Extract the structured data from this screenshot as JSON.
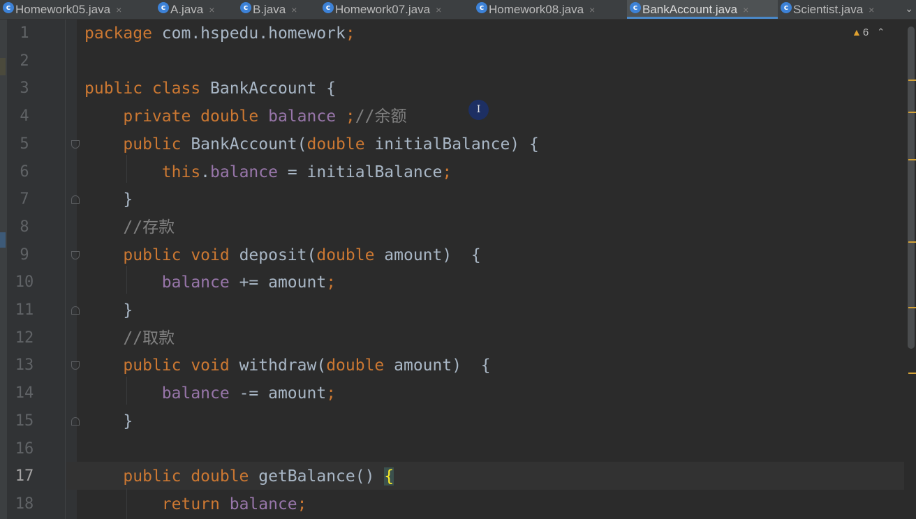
{
  "tabs": [
    {
      "label": "Homework05.java",
      "active": false,
      "closable": true
    },
    {
      "label": "A.java",
      "active": false,
      "closable": true
    },
    {
      "label": "B.java",
      "active": false,
      "closable": true
    },
    {
      "label": "Homework07.java",
      "active": false,
      "closable": true
    },
    {
      "label": "Homework08.java",
      "active": false,
      "closable": true
    },
    {
      "label": "BankAccount.java",
      "active": true,
      "closable": true
    },
    {
      "label": "Scientist.java",
      "active": false,
      "closable": true
    }
  ],
  "tab_icon_glyph": "c",
  "tab_close_glyph": "×",
  "inspection": {
    "warning_icon": "warning-icon",
    "warning_glyph": "▲",
    "count": "6",
    "up_glyph": "⌃",
    "down_glyph": "⌄"
  },
  "current_line": "17",
  "line_numbers": [
    "1",
    "2",
    "3",
    "4",
    "5",
    "6",
    "7",
    "8",
    "9",
    "10",
    "11",
    "12",
    "13",
    "14",
    "15",
    "16",
    "17",
    "18"
  ],
  "code": [
    [
      {
        "t": "kw",
        "s": "package"
      },
      {
        "t": "pl",
        "s": " com.hspedu.homework"
      },
      {
        "t": "kw",
        "s": ";"
      }
    ],
    [],
    [
      {
        "t": "kw",
        "s": "public class "
      },
      {
        "t": "pl",
        "s": "BankAccount {"
      }
    ],
    [
      {
        "t": "pl",
        "s": "    "
      },
      {
        "t": "kw",
        "s": "private double "
      },
      {
        "t": "fld",
        "s": "balance"
      },
      {
        "t": "pl",
        "s": " "
      },
      {
        "t": "kw",
        "s": ";"
      },
      {
        "t": "cmt",
        "s": "//余额"
      }
    ],
    [
      {
        "t": "pl",
        "s": "    "
      },
      {
        "t": "kw",
        "s": "public "
      },
      {
        "t": "pl",
        "s": "BankAccount("
      },
      {
        "t": "kw",
        "s": "double "
      },
      {
        "t": "pl",
        "s": "initialBalance) {"
      }
    ],
    [
      {
        "t": "pl",
        "s": "        "
      },
      {
        "t": "kw",
        "s": "this"
      },
      {
        "t": "pl",
        "s": "."
      },
      {
        "t": "fld",
        "s": "balance"
      },
      {
        "t": "pl",
        "s": " = initialBalance"
      },
      {
        "t": "kw",
        "s": ";"
      }
    ],
    [
      {
        "t": "pl",
        "s": "    }"
      }
    ],
    [
      {
        "t": "pl",
        "s": "    "
      },
      {
        "t": "cmt",
        "s": "//存款"
      }
    ],
    [
      {
        "t": "pl",
        "s": "    "
      },
      {
        "t": "kw",
        "s": "public void "
      },
      {
        "t": "pl",
        "s": "deposit("
      },
      {
        "t": "kw",
        "s": "double "
      },
      {
        "t": "pl",
        "s": "amount)  {"
      }
    ],
    [
      {
        "t": "pl",
        "s": "        "
      },
      {
        "t": "fld",
        "s": "balance"
      },
      {
        "t": "pl",
        "s": " += amount"
      },
      {
        "t": "kw",
        "s": ";"
      }
    ],
    [
      {
        "t": "pl",
        "s": "    }"
      }
    ],
    [
      {
        "t": "pl",
        "s": "    "
      },
      {
        "t": "cmt",
        "s": "//取款"
      }
    ],
    [
      {
        "t": "pl",
        "s": "    "
      },
      {
        "t": "kw",
        "s": "public void "
      },
      {
        "t": "pl",
        "s": "withdraw("
      },
      {
        "t": "kw",
        "s": "double "
      },
      {
        "t": "pl",
        "s": "amount)  {"
      }
    ],
    [
      {
        "t": "pl",
        "s": "        "
      },
      {
        "t": "fld",
        "s": "balance"
      },
      {
        "t": "pl",
        "s": " -= amount"
      },
      {
        "t": "kw",
        "s": ";"
      }
    ],
    [
      {
        "t": "pl",
        "s": "    }"
      }
    ],
    [],
    [
      {
        "t": "pl",
        "s": "    "
      },
      {
        "t": "kw",
        "s": "public double "
      },
      {
        "t": "pl",
        "s": "getBalance() "
      },
      {
        "t": "brace",
        "s": "{"
      }
    ],
    [
      {
        "t": "pl",
        "s": "        "
      },
      {
        "t": "kw",
        "s": "return "
      },
      {
        "t": "fld",
        "s": "balance"
      },
      {
        "t": "kw",
        "s": ";"
      }
    ]
  ],
  "colors": {
    "keyword": "#cc7832",
    "field": "#9876aa",
    "comment": "#808080",
    "plain": "#a9b7c6",
    "active_tab_underline": "#4a88c7",
    "warning": "#e0a12f"
  },
  "mouse_cursor_glyph": "I"
}
